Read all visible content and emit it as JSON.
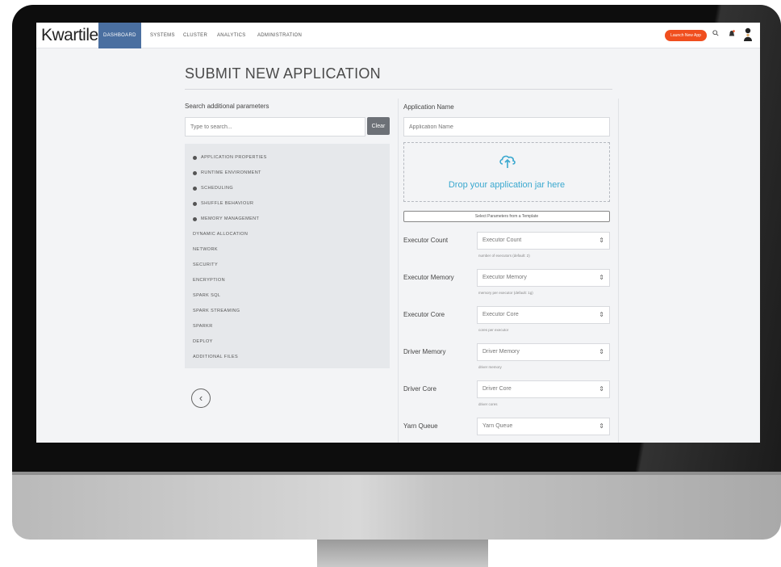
{
  "app": {
    "logo": "Kwartile"
  },
  "nav": {
    "items": [
      {
        "label": "DASHBOARD",
        "active": true
      },
      {
        "label": "SYSTEMS",
        "active": false
      },
      {
        "label": "CLUSTER",
        "active": false
      },
      {
        "label": "ANALYTICS",
        "active": false
      },
      {
        "label": "ADMINISTRATION",
        "active": false
      }
    ],
    "launch_button": "Launch New App",
    "icons": [
      "search-icon",
      "notification-icon",
      "user-avatar-icon"
    ]
  },
  "page": {
    "title": "SUBMIT NEW APPLICATION"
  },
  "search": {
    "label": "Search additional parameters",
    "placeholder": "Type to search...",
    "clear_label": "Clear"
  },
  "parameters": [
    {
      "label": "APPLICATION PROPERTIES",
      "expandable": true
    },
    {
      "label": "RUNTIME ENVIRONMENT",
      "expandable": true
    },
    {
      "label": "SCHEDULING",
      "expandable": true
    },
    {
      "label": "SHUFFLE BEHAVIOUR",
      "expandable": true
    },
    {
      "label": "MEMORY MANAGEMENT",
      "expandable": true
    },
    {
      "label": "DYNAMIC ALLOCATION",
      "expandable": false
    },
    {
      "label": "NETWORK",
      "expandable": false
    },
    {
      "label": "SECURITY",
      "expandable": false
    },
    {
      "label": "ENCRYPTION",
      "expandable": false
    },
    {
      "label": "SPARK SQL",
      "expandable": false
    },
    {
      "label": "SPARK STREAMING",
      "expandable": false
    },
    {
      "label": "SPARKR",
      "expandable": false
    },
    {
      "label": "DEPLOY",
      "expandable": false
    },
    {
      "label": "ADDITIONAL FILES",
      "expandable": false
    }
  ],
  "application": {
    "name_label": "Application Name",
    "name_placeholder": "Application Name",
    "drop_text": "Drop your application jar here",
    "template_button": "Select Parameters from a Template"
  },
  "fields": [
    {
      "label": "Executor Count",
      "placeholder": "Executor Count",
      "hint": "number of executors (default: 2)"
    },
    {
      "label": "Executor Memory",
      "placeholder": "Executor Memory",
      "hint": "memory per executor (default: 1g)"
    },
    {
      "label": "Executor Core",
      "placeholder": "Executor Core",
      "hint": "cores per executor"
    },
    {
      "label": "Driver Memory",
      "placeholder": "Driver Memory",
      "hint": "driver memory"
    },
    {
      "label": "Driver Core",
      "placeholder": "Driver Core",
      "hint": "driver cores"
    },
    {
      "label": "Yarn Queue",
      "placeholder": "Yarn Queue",
      "hint": ""
    }
  ],
  "colors": {
    "accent": "#4a6fa0",
    "launch": "#f04e1e",
    "drop_text": "#3aa8cf"
  }
}
